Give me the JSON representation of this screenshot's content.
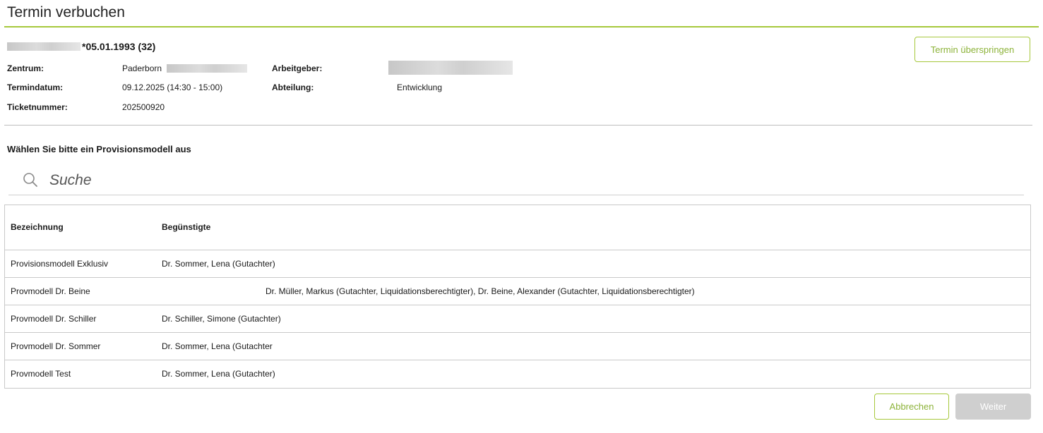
{
  "header": {
    "title": "Termin verbuchen",
    "patient_info": "*05.01.1993 (32)",
    "skip_button": "Termin überspringen"
  },
  "details": {
    "zentrum_label": "Zentrum:",
    "zentrum_value": "Paderborn",
    "termindatum_label": "Termindatum:",
    "termindatum_value": "09.12.2025 (14:30 - 15:00)",
    "ticket_label": "Ticketnummer:",
    "ticket_value": "202500920",
    "arbeitgeber_label": "Arbeitgeber:",
    "abteilung_label": "Abteilung:",
    "abteilung_value": "Entwicklung"
  },
  "selection": {
    "heading": "Wählen Sie bitte ein Provisionsmodell aus",
    "search_placeholder": "Suche"
  },
  "table": {
    "columns": [
      "Bezeichnung",
      "Begünstigte"
    ],
    "rows": [
      [
        "Provisionsmodell Exklusiv",
        "Dr. Sommer, Lena (Gutachter)"
      ],
      [
        "Provmodell Dr. Beine",
        "Dr. Müller, Markus (Gutachter, Liquidationsberechtigter), Dr. Beine, Alexander (Gutachter, Liquidationsberechtigter)"
      ],
      [
        "Provmodell Dr. Schiller",
        "Dr. Schiller, Simone (Gutachter)"
      ],
      [
        "Provmodell Dr. Sommer",
        "Dr. Sommer, Lena (Gutachter"
      ],
      [
        "Provmodell Test",
        "Dr. Sommer, Lena (Gutachter)"
      ]
    ]
  },
  "footer": {
    "cancel_button": "Abbrechen",
    "next_button": "Weiter"
  },
  "colors": {
    "accent": "#a6c83b",
    "disabled": "#cfcfcf"
  }
}
